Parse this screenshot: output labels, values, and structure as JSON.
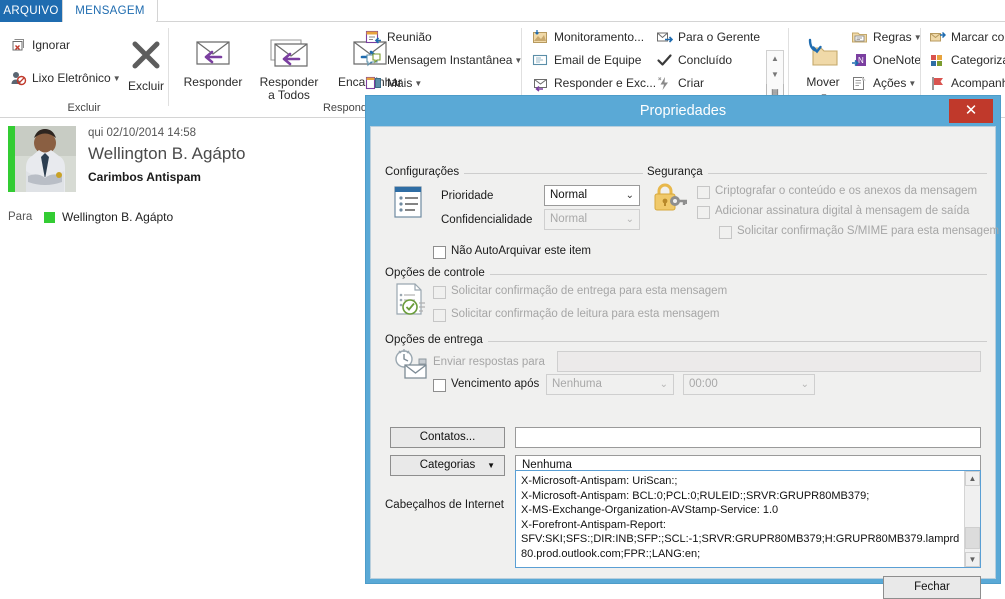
{
  "ribbon": {
    "tabs": [
      {
        "label": "ARQUIVO",
        "name": "tab-arquivo"
      },
      {
        "label": "MENSAGEM",
        "name": "tab-mensagem"
      }
    ],
    "groups": {
      "excluir": {
        "label": "Excluir",
        "ignore": "Ignorar",
        "junk": "Lixo Eletrônico",
        "delete": "Excluir"
      },
      "responder": {
        "label": "Respond",
        "reply": "Responder",
        "reply_all_1": "Responder",
        "reply_all_2": "a Todos",
        "forward": "Encaminhar",
        "meeting": "Reunião",
        "im": "Mensagem Instantânea",
        "more": "Mais"
      },
      "etapas": {
        "monitoring": "Monitoramento...",
        "team_email": "Email de Equipe",
        "reply_delete": "Responder e Exc...",
        "to_manager": "Para o Gerente",
        "done": "Concluído",
        "create": "Criar"
      },
      "mover": {
        "move": "Mover",
        "rules": "Regras",
        "onenote": "OneNote",
        "actions": "Ações"
      },
      "marcas": {
        "mark_as": "Marcar cor",
        "categorize": "Categoriza",
        "followup": "Acompanh"
      }
    }
  },
  "mail": {
    "date": "qui 02/10/2014 14:58",
    "from": "Wellington B. Agápto",
    "subject": "Carimbos Antispam",
    "to_label": "Para",
    "to": "Wellington B. Agápto"
  },
  "dialog": {
    "title": "Propriedades",
    "close_icon": "close-icon",
    "close_glyph": "✕",
    "settings": {
      "title": "Configurações",
      "priority_label": "Prioridade",
      "priority_value": "Normal",
      "sensitivity_label": "Confidencialidade",
      "sensitivity_value": "Normal",
      "no_autoarchive": "Não AutoArquivar este item"
    },
    "security": {
      "title": "Segurança",
      "encrypt": "Criptografar o conteúdo e os anexos da mensagem",
      "sign": "Adicionar assinatura digital à mensagem de saída",
      "smime": "Solicitar confirmação S/MIME para esta mensagem"
    },
    "tracking": {
      "title": "Opções de controle",
      "delivery_receipt": "Solicitar confirmação de entrega para esta mensagem",
      "read_receipt": "Solicitar confirmação de leitura para esta mensagem"
    },
    "delivery": {
      "title": "Opções de entrega",
      "reply_to_label": "Enviar respostas para",
      "reply_to_value": "",
      "expires_label": "Vencimento após",
      "expires_date": "Nenhuma",
      "expires_time": "00:00"
    },
    "contacts_button": "Contatos...",
    "contacts_value": "",
    "categories_button": "Categorias",
    "categories_value": "Nenhuma",
    "headers_label": "Cabeçalhos de Internet",
    "headers_value": "X-Microsoft-Antispam: UriScan:;\nX-Microsoft-Antispam: BCL:0;PCL:0;RULEID:;SRVR:GRUPR80MB379;\nX-MS-Exchange-Organization-AVStamp-Service: 1.0\nX-Forefront-Antispam-Report:\nSFV:SKI;SFS:;DIR:INB;SFP:;SCL:-1;SRVR:GRUPR80MB379;H:GRUPR80MB379.lamprd80.prod.outlook.com;FPR:;LANG:en;",
    "close_button": "Fechar"
  },
  "colors": {
    "file_tab": "#1f6cb0",
    "dialog_chrome": "#5aa9d6",
    "close_red": "#c0392b",
    "presence_green": "#33cc33"
  }
}
